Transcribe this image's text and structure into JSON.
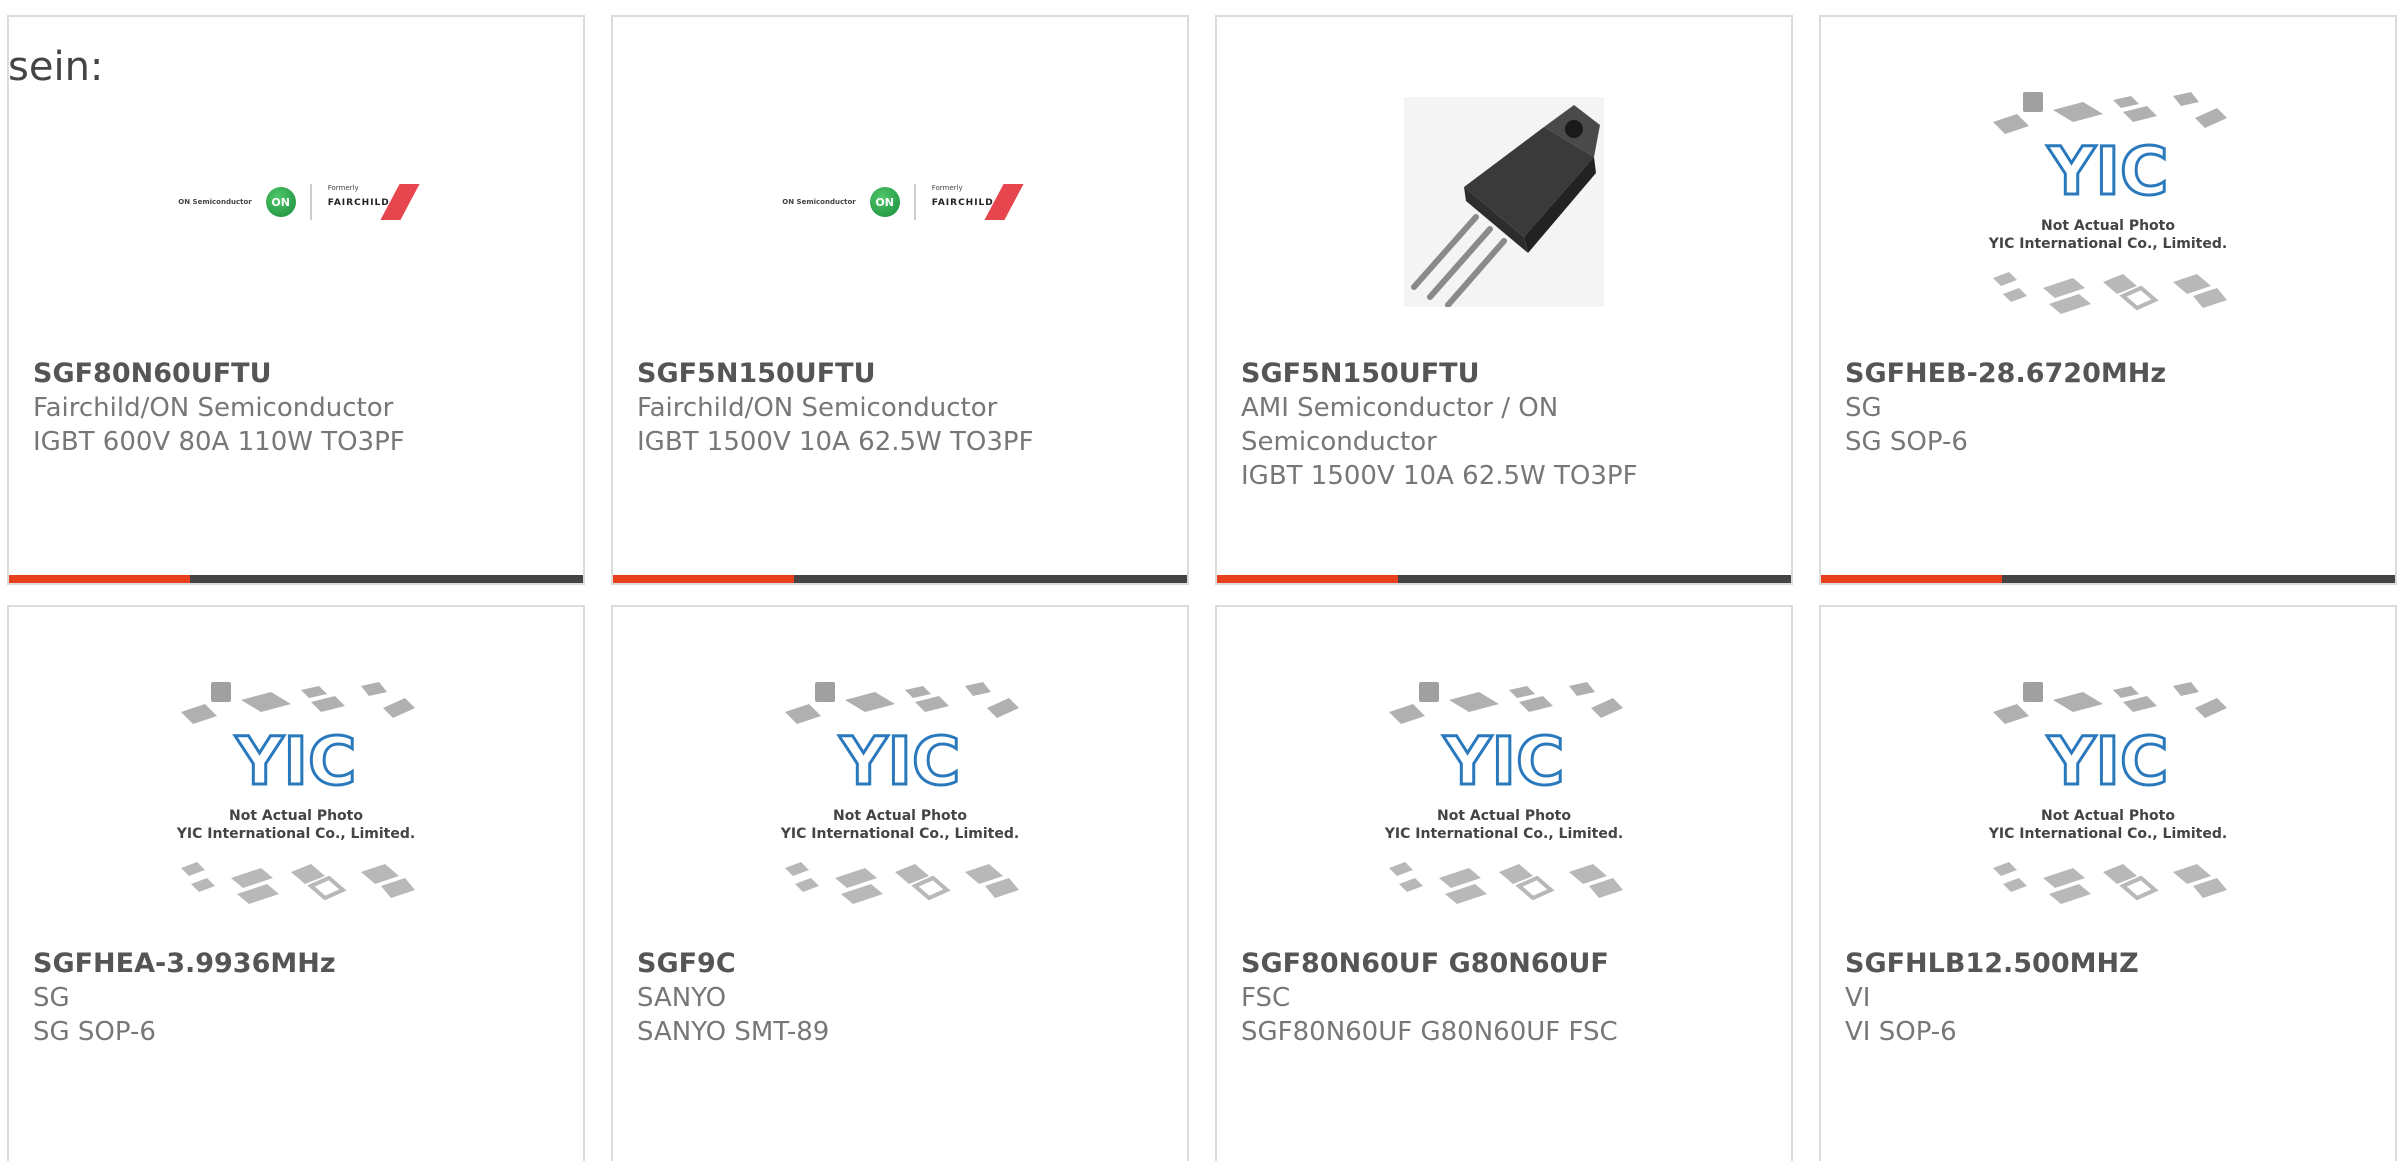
{
  "intro_text": "sein:",
  "colors": {
    "accent": "#e8401c",
    "bar_track": "#444444",
    "card_border": "#dcdcdc",
    "yic_blue": "#2a79bd"
  },
  "products": [
    {
      "part_number": "SGF80N60UFTU",
      "manufacturer": "Fairchild/ON Semiconductor",
      "description": "IGBT 600V 80A 110W TO3PF",
      "image": "on-fairchild-logo",
      "logo": {
        "on_text": "ON Semiconductor",
        "on_circle": "ON",
        "formerly": "Formerly",
        "fairchild": "FAIRCHILD"
      },
      "progress": 0.315
    },
    {
      "part_number": "SGF5N150UFTU",
      "manufacturer": "Fairchild/ON Semiconductor",
      "description": "IGBT 1500V 10A 62.5W TO3PF",
      "image": "on-fairchild-logo",
      "logo": {
        "on_text": "ON Semiconductor",
        "on_circle": "ON",
        "formerly": "Formerly",
        "fairchild": "FAIRCHILD"
      },
      "progress": 0.315
    },
    {
      "part_number": "SGF5N150UFTU",
      "manufacturer": "AMI Semiconductor / ON Semiconductor",
      "description": "IGBT 1500V 10A 62.5W TO3PF",
      "image": "to220-package-photo",
      "progress": 0.315
    },
    {
      "part_number": "SGFHEB-28.6720MHz",
      "manufacturer": "SG",
      "description": "SG SOP-6",
      "image": "yic-placeholder",
      "placeholder": {
        "brand": "YIC",
        "line1": "Not Actual Photo",
        "line2": "YIC International Co., Limited."
      },
      "progress": 0.315
    },
    {
      "part_number": "SGFHEA-3.9936MHz",
      "manufacturer": "SG",
      "description": "SG SOP-6",
      "image": "yic-placeholder",
      "placeholder": {
        "brand": "YIC",
        "line1": "Not Actual Photo",
        "line2": "YIC International Co., Limited."
      }
    },
    {
      "part_number": "SGF9C",
      "manufacturer": "SANYO",
      "description": "SANYO SMT-89",
      "image": "yic-placeholder",
      "placeholder": {
        "brand": "YIC",
        "line1": "Not Actual Photo",
        "line2": "YIC International Co., Limited."
      }
    },
    {
      "part_number": "SGF80N60UF G80N60UF",
      "manufacturer": "FSC",
      "description": "SGF80N60UF G80N60UF FSC",
      "image": "yic-placeholder",
      "placeholder": {
        "brand": "YIC",
        "line1": "Not Actual Photo",
        "line2": "YIC International Co., Limited."
      }
    },
    {
      "part_number": "SGFHLB12.500MHZ",
      "manufacturer": "VI",
      "description": "VI SOP-6",
      "image": "yic-placeholder",
      "placeholder": {
        "brand": "YIC",
        "line1": "Not Actual Photo",
        "line2": "YIC International Co., Limited."
      }
    }
  ]
}
